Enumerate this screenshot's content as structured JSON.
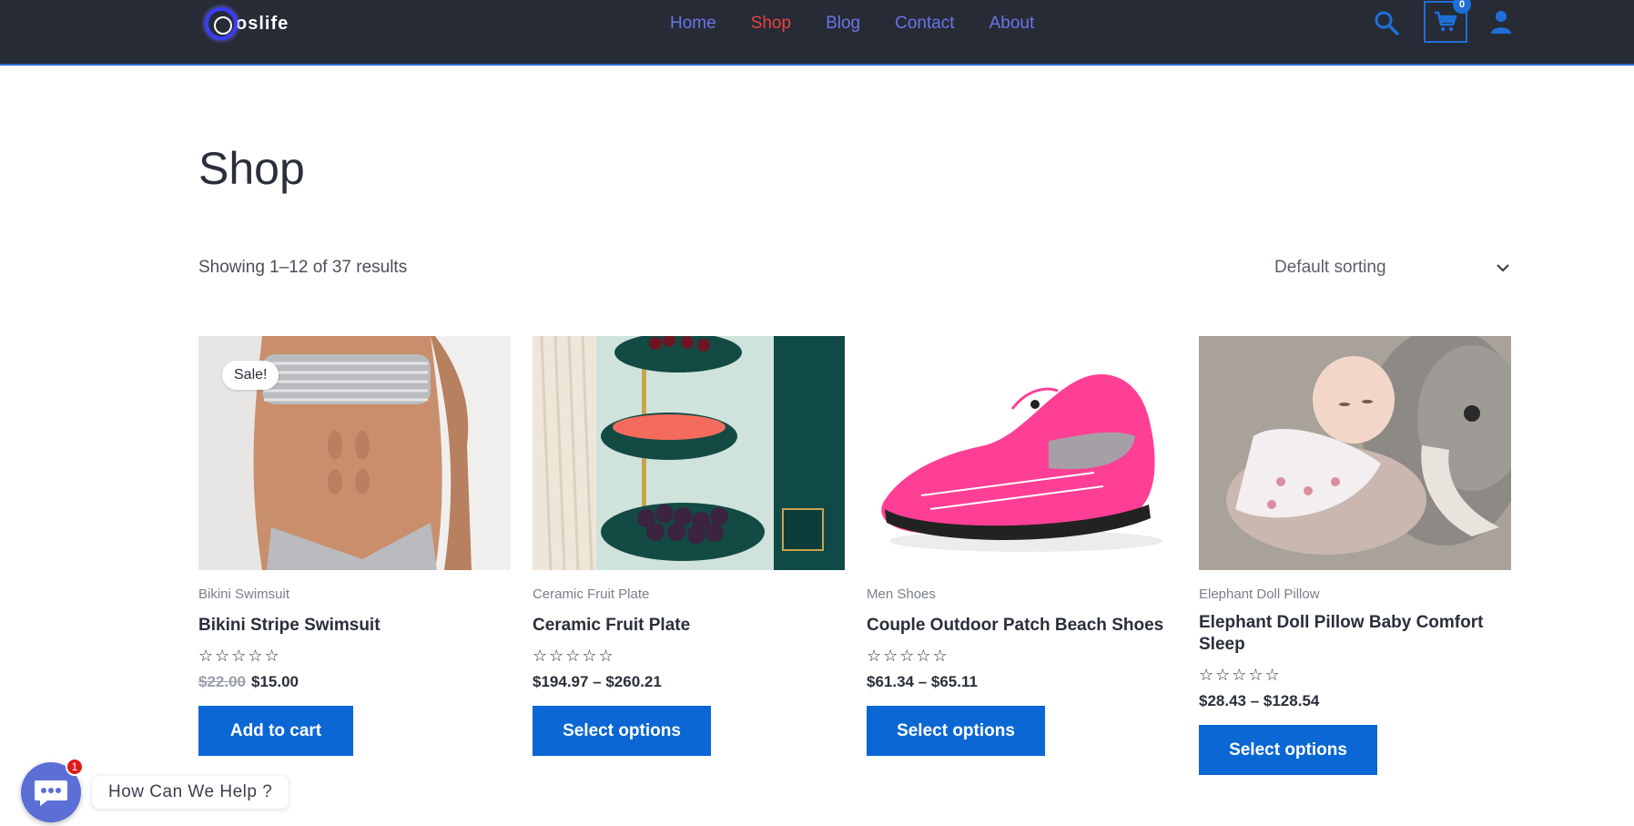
{
  "header": {
    "logo_text": "oslife",
    "nav": [
      {
        "label": "Home",
        "active": false
      },
      {
        "label": "Shop",
        "active": true
      },
      {
        "label": "Blog",
        "active": false
      },
      {
        "label": "Contact",
        "active": false
      },
      {
        "label": "About",
        "active": false
      }
    ],
    "cart_count": "0",
    "icons": [
      "search-icon",
      "cart-icon",
      "user-icon"
    ],
    "colors": {
      "background": "#262b35",
      "nav_link": "#6b74e8",
      "nav_active": "#e64545",
      "accent": "#1f6fd8"
    }
  },
  "main": {
    "title": "Shop",
    "result_count": "Showing 1–12 of 37 results",
    "sorting": {
      "selected": "Default sorting"
    }
  },
  "products": [
    {
      "category": "Bikini Swimsuit",
      "name": "Bikini Stripe Swimsuit",
      "sale_badge": "Sale!",
      "old_price": "$22.00",
      "price": "$15.00",
      "rating": 0,
      "button": "Add to cart"
    },
    {
      "category": "Ceramic Fruit Plate",
      "name": "Ceramic Fruit Plate",
      "price": "$194.97 – $260.21",
      "rating": 0,
      "button": "Select options"
    },
    {
      "category": "Men Shoes",
      "name": "Couple Outdoor Patch Beach Shoes",
      "price": "$61.34 – $65.11",
      "rating": 0,
      "button": "Select options"
    },
    {
      "category": "Elephant Doll Pillow",
      "name": "Elephant Doll Pillow Baby Comfort Sleep",
      "price": "$28.43 – $128.54",
      "rating": 0,
      "button": "Select options"
    }
  ],
  "stars_text": "☆☆☆☆☆",
  "chat": {
    "label": "How Can We Help ?",
    "badge": "1"
  },
  "colors": {
    "button": "#0b67d3",
    "text": "#2a2f3a"
  }
}
